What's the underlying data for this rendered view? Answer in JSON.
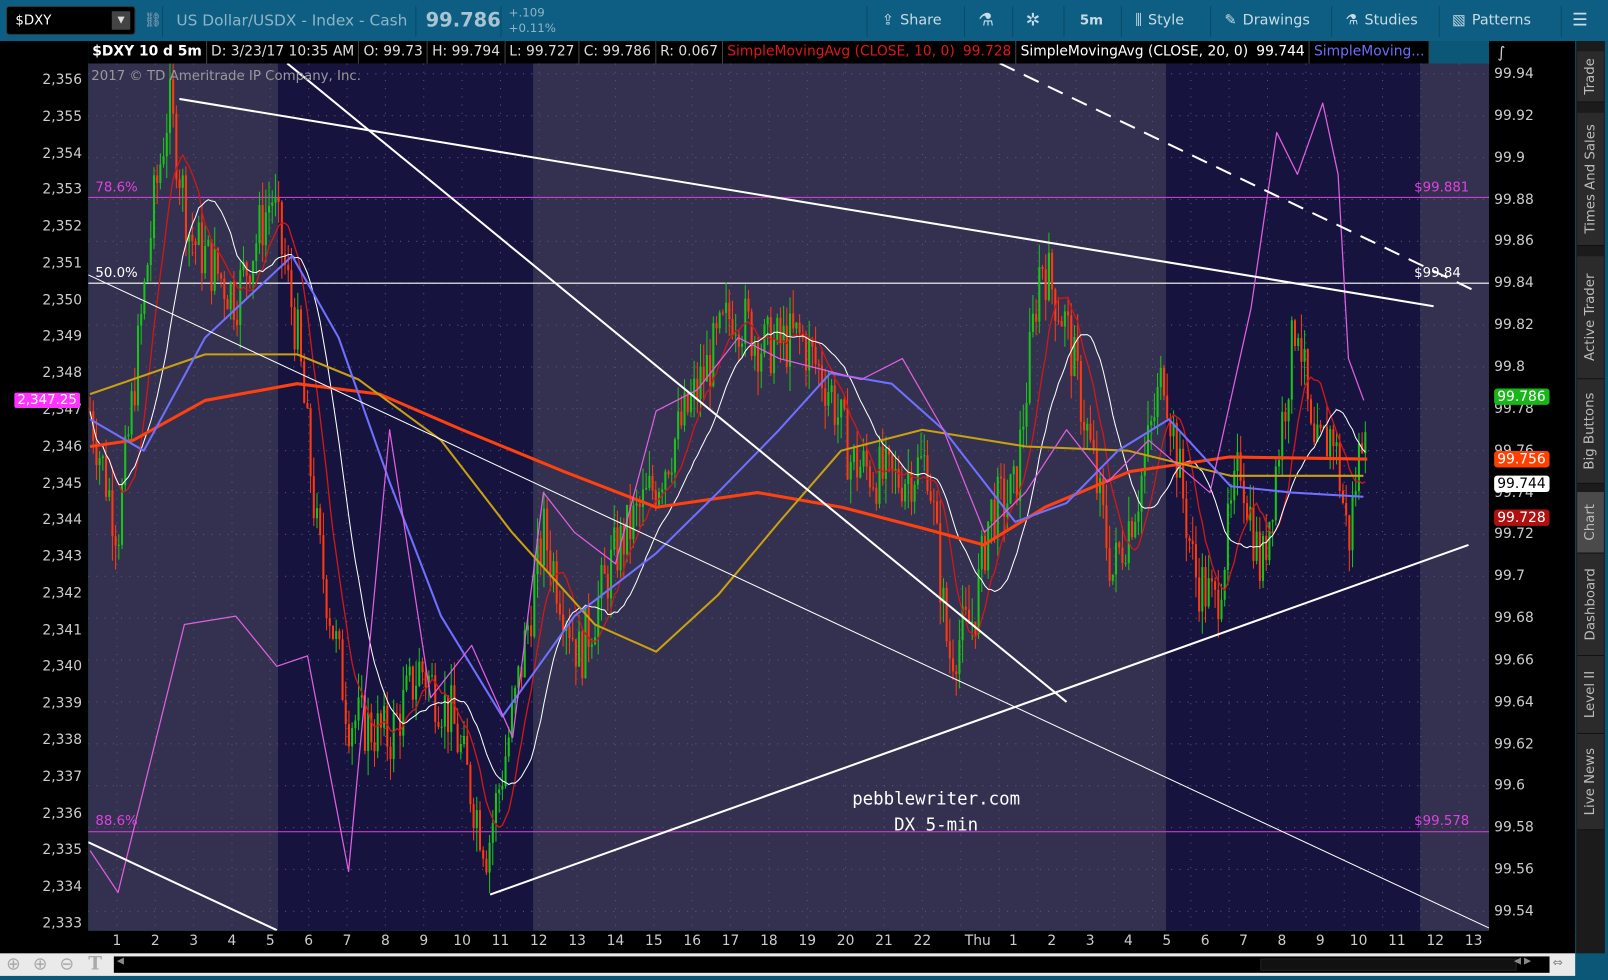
{
  "toolbar": {
    "symbol": "$DXY",
    "description": "US Dollar/USDX - Index - Cash",
    "last": "99.786",
    "change": "+.109",
    "change_pct": "+0.11%",
    "share": "Share",
    "timeframe": "5m",
    "style": "Style",
    "drawings": "Drawings",
    "studies": "Studies",
    "patterns": "Patterns"
  },
  "infobar": {
    "title": "$DXY 10 d 5m",
    "date": "D: 3/23/17 10:35 AM",
    "open": "O: 99.73",
    "high": "H: 99.794",
    "low": "L: 99.727",
    "close": "C: 99.786",
    "range": "R: 0.067",
    "sma10_label": "SimpleMovingAvg (CLOSE, 10, 0)",
    "sma10_value": "99.728",
    "sma20_label": "SimpleMovingAvg (CLOSE, 20, 0)",
    "sma20_value": "99.744",
    "sma3_label": "SimpleMoving..."
  },
  "copyright": "2017 © TD Ameritrade IP Company, Inc.",
  "watermark": {
    "line1": "pebblewriter.com",
    "line2": "DX 5-min"
  },
  "fib": [
    {
      "label": "78.6%",
      "price": 99.881,
      "value_label": "$99.881",
      "color": "#e040e0"
    },
    {
      "label": "50.0%",
      "price": 99.84,
      "value_label": "$99.84",
      "color": "#ffffff"
    },
    {
      "label": "88.6%",
      "price": 99.578,
      "value_label": "$99.578",
      "color": "#e040e0"
    }
  ],
  "left_axis": {
    "ticks": [
      "2,333",
      "2,334",
      "2,335",
      "2,336",
      "2,337",
      "2,338",
      "2,339",
      "2,340",
      "2,341",
      "2,342",
      "2,343",
      "2,344",
      "2,345",
      "2,346",
      "2,347",
      "2,348",
      "2,349",
      "2,350",
      "2,351",
      "2,352",
      "2,353",
      "2,354",
      "2,355",
      "2,356"
    ],
    "marker": "2,347.25",
    "marker_color": "#ff33ff"
  },
  "right_axis": {
    "ticks": [
      "99.54",
      "99.56",
      "99.58",
      "99.6",
      "99.62",
      "99.64",
      "99.66",
      "99.68",
      "99.7",
      "99.72",
      "99.74",
      "99.76",
      "99.78",
      "99.8",
      "99.82",
      "99.84",
      "99.86",
      "99.88",
      "99.9",
      "99.92",
      "99.94"
    ],
    "badges": [
      {
        "value": "99.786",
        "bg": "#19b619",
        "fg": "#ffffff"
      },
      {
        "value": "99.756",
        "bg": "#ff4000",
        "fg": "#ffffff"
      },
      {
        "value": "99.744",
        "bg": "#ffffff",
        "fg": "#000000"
      },
      {
        "value": "99.728",
        "bg": "#b01010",
        "fg": "#ffffff"
      }
    ]
  },
  "x_axis": {
    "ticks": [
      "1",
      "2",
      "3",
      "4",
      "5",
      "6",
      "7",
      "8",
      "9",
      "10",
      "11",
      "12",
      "13",
      "14",
      "15",
      "16",
      "17",
      "18",
      "19",
      "20",
      "21",
      "22",
      "Thu",
      "1",
      "2",
      "3",
      "4",
      "5",
      "6",
      "7",
      "8",
      "9",
      "10",
      "11",
      "12",
      "13"
    ]
  },
  "sidebar": {
    "tabs": [
      "Trade",
      "Times And Sales",
      "Active Trader",
      "Big Buttons",
      "Chart",
      "Dashboard",
      "Level II",
      "Live News"
    ],
    "active": "Chart"
  },
  "chart_data": {
    "type": "candlestick",
    "y_range": [
      99.53,
      99.947
    ],
    "price_path": [
      [
        -0.7,
        99.779
      ],
      [
        0.03,
        99.721
      ],
      [
        0.96,
        99.877
      ],
      [
        1.36,
        99.926
      ],
      [
        1.9,
        99.863
      ],
      [
        3.1,
        99.833
      ],
      [
        4.04,
        99.882
      ],
      [
        4.71,
        99.814
      ],
      [
        5.24,
        99.716
      ],
      [
        6.04,
        99.633
      ],
      [
        7.11,
        99.623
      ],
      [
        7.91,
        99.657
      ],
      [
        8.72,
        99.633
      ],
      [
        9.65,
        99.569
      ],
      [
        10.32,
        99.633
      ],
      [
        11.12,
        99.721
      ],
      [
        12.06,
        99.662
      ],
      [
        13.0,
        99.711
      ],
      [
        14.06,
        99.745
      ],
      [
        15.13,
        99.789
      ],
      [
        16.07,
        99.828
      ],
      [
        16.87,
        99.809
      ],
      [
        17.81,
        99.814
      ],
      [
        18.61,
        99.789
      ],
      [
        19.14,
        99.755
      ],
      [
        20.21,
        99.745
      ],
      [
        21.15,
        99.755
      ],
      [
        21.68,
        99.662
      ],
      [
        22.35,
        99.681
      ],
      [
        22.75,
        99.73
      ],
      [
        23.42,
        99.74
      ],
      [
        24.09,
        99.853
      ],
      [
        24.76,
        99.819
      ],
      [
        25.29,
        99.77
      ],
      [
        25.96,
        99.701
      ],
      [
        26.63,
        99.74
      ],
      [
        27.3,
        99.799
      ],
      [
        28.1,
        99.701
      ],
      [
        28.64,
        99.686
      ],
      [
        29.3,
        99.755
      ],
      [
        29.84,
        99.701
      ],
      [
        30.78,
        99.828
      ],
      [
        31.18,
        99.755
      ],
      [
        31.71,
        99.77
      ],
      [
        32.11,
        99.716
      ],
      [
        32.57,
        99.786
      ]
    ],
    "overlays": [
      {
        "color": "#ff4010",
        "points": [
          [
            -0.7,
            99.762
          ],
          [
            0.43,
            99.765
          ],
          [
            2.3,
            99.784
          ],
          [
            4.7,
            99.792
          ],
          [
            6.85,
            99.787
          ],
          [
            9.0,
            99.77
          ],
          [
            11.66,
            99.75
          ],
          [
            14.06,
            99.733
          ],
          [
            16.7,
            99.74
          ],
          [
            18.9,
            99.733
          ],
          [
            21.0,
            99.723
          ],
          [
            22.6,
            99.715
          ],
          [
            24.2,
            99.733
          ],
          [
            26.4,
            99.75
          ],
          [
            29.0,
            99.757
          ],
          [
            32.6,
            99.756
          ]
        ]
      },
      {
        "color": "#c8a010",
        "points": [
          [
            -0.7,
            99.787
          ],
          [
            2.3,
            99.806
          ],
          [
            4.7,
            99.806
          ],
          [
            6.3,
            99.794
          ],
          [
            8.45,
            99.765
          ],
          [
            10.3,
            99.721
          ],
          [
            12.46,
            99.677
          ],
          [
            14.06,
            99.664
          ],
          [
            15.67,
            99.691
          ],
          [
            17.27,
            99.726
          ],
          [
            18.88,
            99.76
          ],
          [
            21.0,
            99.77
          ],
          [
            23.7,
            99.762
          ],
          [
            26.36,
            99.76
          ],
          [
            29.04,
            99.748
          ],
          [
            32.5,
            99.748
          ]
        ]
      },
      {
        "color": "#7070ff",
        "points": [
          [
            -0.7,
            99.775
          ],
          [
            0.7,
            99.76
          ],
          [
            2.3,
            99.814
          ],
          [
            4.57,
            99.853
          ],
          [
            5.78,
            99.814
          ],
          [
            7.11,
            99.745
          ],
          [
            8.45,
            99.681
          ],
          [
            10.05,
            99.633
          ],
          [
            11.93,
            99.681
          ],
          [
            14.06,
            99.711
          ],
          [
            15.67,
            99.74
          ],
          [
            17.27,
            99.77
          ],
          [
            18.6,
            99.797
          ],
          [
            20.2,
            99.792
          ],
          [
            21.55,
            99.77
          ],
          [
            23.42,
            99.726
          ],
          [
            24.76,
            99.735
          ],
          [
            26.1,
            99.76
          ],
          [
            27.43,
            99.775
          ],
          [
            29.04,
            99.743
          ],
          [
            30.64,
            99.74
          ],
          [
            32.5,
            99.738
          ]
        ]
      },
      {
        "color": "#e060e0",
        "points": [
          [
            -0.7,
            99.569
          ],
          [
            0.03,
            99.549
          ],
          [
            1.76,
            99.677
          ],
          [
            3.1,
            99.681
          ],
          [
            4.17,
            99.657
          ],
          [
            4.97,
            99.662
          ],
          [
            6.04,
            99.559
          ],
          [
            7.11,
            99.77
          ],
          [
            8.18,
            99.642
          ],
          [
            9.25,
            99.667
          ],
          [
            10.32,
            99.623
          ],
          [
            11.12,
            99.74
          ],
          [
            11.93,
            99.721
          ],
          [
            13.0,
            99.706
          ],
          [
            14.06,
            99.779
          ],
          [
            15.13,
            99.789
          ],
          [
            16.2,
            99.814
          ],
          [
            17.27,
            99.804
          ],
          [
            18.34,
            99.799
          ],
          [
            19.41,
            99.794
          ],
          [
            20.48,
            99.804
          ],
          [
            21.55,
            99.77
          ],
          [
            22.62,
            99.721
          ],
          [
            23.69,
            99.74
          ],
          [
            24.76,
            99.77
          ],
          [
            25.83,
            99.745
          ],
          [
            26.9,
            99.765
          ],
          [
            28.5,
            99.74
          ],
          [
            29.57,
            99.828
          ],
          [
            30.24,
            99.912
          ],
          [
            30.78,
            99.892
          ],
          [
            31.44,
            99.926
          ],
          [
            31.84,
            99.892
          ],
          [
            32.11,
            99.804
          ],
          [
            32.51,
            99.784
          ]
        ]
      }
    ],
    "trendlines": [
      {
        "from": [
          1.63,
          99.928
        ],
        "to": [
          34.33,
          99.829
        ],
        "style": "solid"
      },
      {
        "from": [
          4.44,
          99.945
        ],
        "to": [
          24.76,
          99.64
        ],
        "style": "solid"
      },
      {
        "from": [
          -0.75,
          99.844
        ],
        "to": [
          35.78,
          99.532
        ],
        "style": "thin"
      },
      {
        "from": [
          9.73,
          99.548
        ],
        "to": [
          35.24,
          99.715
        ],
        "style": "solid"
      },
      {
        "from": [
          23.02,
          99.945
        ],
        "to": [
          35.45,
          99.836
        ],
        "style": "dashed"
      },
      {
        "from": [
          -0.75,
          99.573
        ],
        "to": [
          4.17,
          99.531
        ],
        "style": "solid"
      }
    ]
  }
}
